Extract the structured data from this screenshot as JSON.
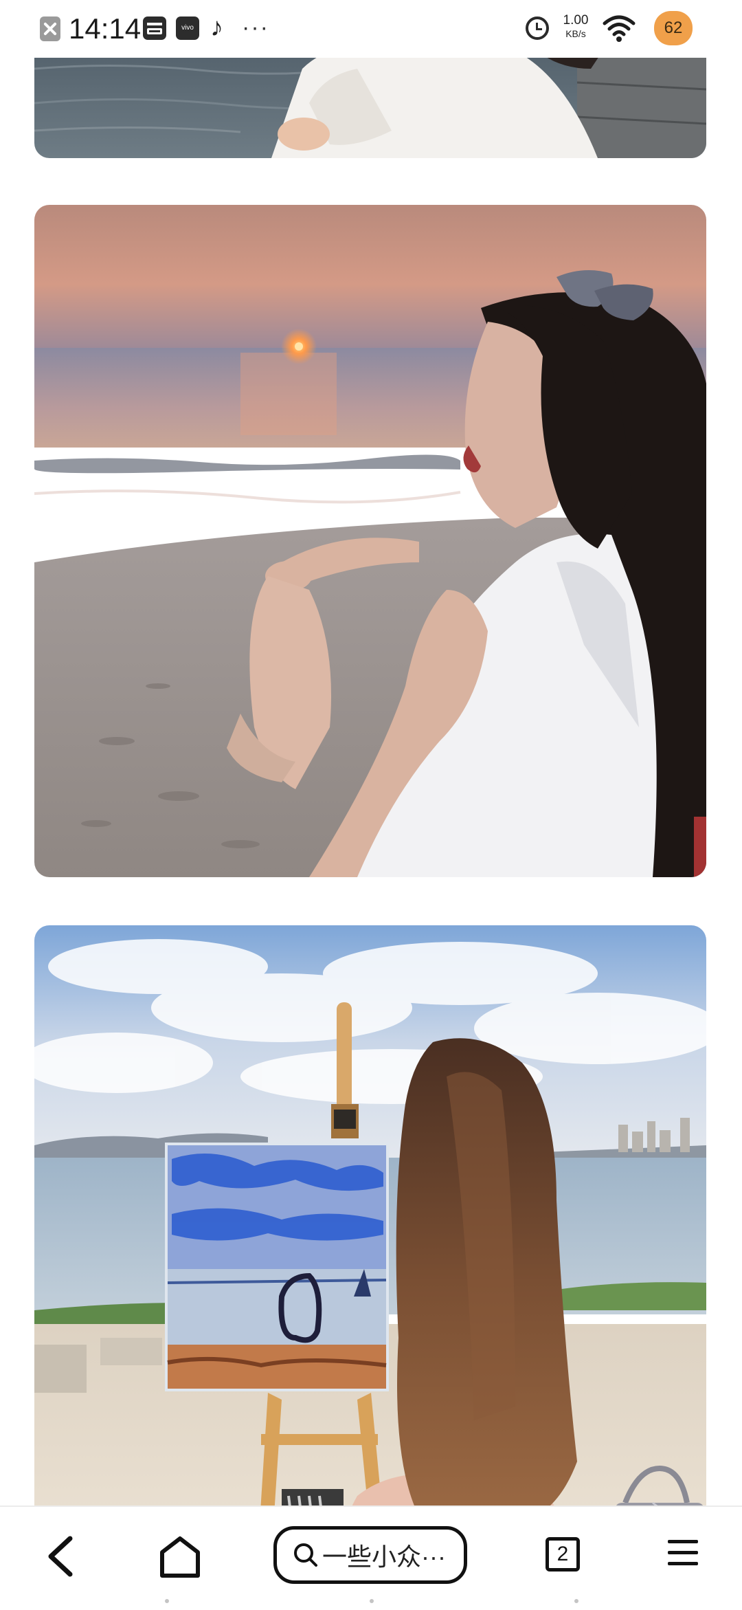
{
  "status_bar": {
    "time": "14:14",
    "vivo_label": "vivo",
    "more": "···",
    "net_speed_value": "1.00",
    "net_speed_unit": "KB/s",
    "battery_level": "62",
    "icons": [
      "close-notification-icon",
      "wallet-icon",
      "vivo-app-icon",
      "tiktok-icon",
      "more-icon",
      "alarm-icon",
      "wifi-icon",
      "battery-icon"
    ]
  },
  "photos": [
    {
      "subject": "woman-in-white-shirt-seaside-cropped"
    },
    {
      "subject": "woman-sitting-on-beach-at-sunset"
    },
    {
      "subject": "woman-painting-on-easel-at-beach"
    }
  ],
  "bottom_nav": {
    "search_text": "一些小众···",
    "tab_count": "2",
    "icons": [
      "back-icon",
      "home-icon",
      "search-icon",
      "tabs-icon",
      "menu-icon"
    ]
  },
  "colors": {
    "background": "#ffffff",
    "icon": "#111111",
    "battery": "#f0a04a"
  }
}
